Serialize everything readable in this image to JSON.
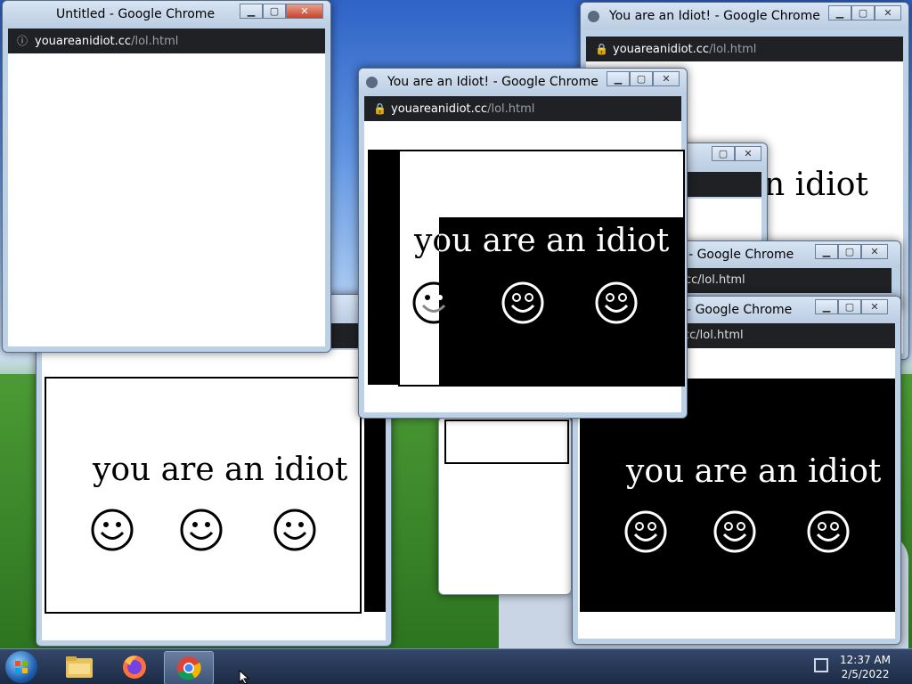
{
  "windows": {
    "untitled": {
      "title": "Untitled - Google Chrome",
      "url_domain": "youareanidiot.cc",
      "url_path": "/lol.html"
    },
    "idiot": {
      "title": "You are an Idiot! - Google Chrome",
      "url_domain": "youareanidiot.cc",
      "url_path": "/lol.html"
    },
    "idiot_partial_title": "! - Google Chrome",
    "idiot_partial_url": "cc/lol.html",
    "slogan": "you are an idiot",
    "slogan_cut": "n idiot"
  },
  "controls": {
    "minimize": "▁",
    "maximize": "▢",
    "close": "✕"
  },
  "taskbar": {
    "start_icon": "windows-start-orb-icon",
    "apps": [
      "file-explorer-icon",
      "firefox-icon",
      "chrome-icon"
    ],
    "time": "12:37 AM",
    "date": "2/5/2022"
  },
  "colors": {
    "address_bar": "#202124",
    "close_button": "#c6452c",
    "taskbar": "#1b2a44"
  }
}
